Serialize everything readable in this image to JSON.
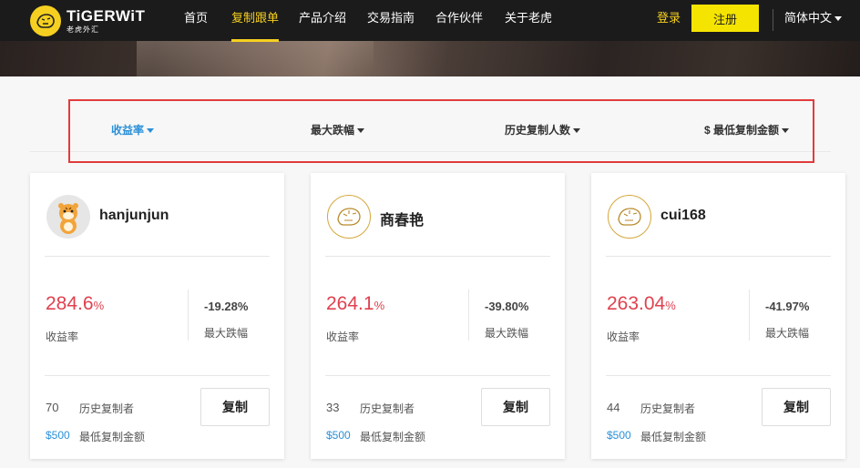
{
  "brand": {
    "name": "TiGERWiT",
    "subtitle": "老虎外汇",
    "accent": "#f5d020"
  },
  "nav": {
    "items": [
      {
        "label": "首页",
        "active": false
      },
      {
        "label": "复制跟单",
        "active": true
      },
      {
        "label": "产品介绍",
        "active": false
      },
      {
        "label": "交易指南",
        "active": false
      },
      {
        "label": "合作伙伴",
        "active": false
      },
      {
        "label": "关于老虎",
        "active": false
      }
    ],
    "login": "登录",
    "register": "注册",
    "language": "简体中文"
  },
  "filters": [
    {
      "label": "收益率",
      "active": true
    },
    {
      "label": "最大跌幅",
      "active": false
    },
    {
      "label": "历史复制人数",
      "active": false
    },
    {
      "label": "$ 最低复制金额",
      "active": false
    }
  ],
  "traders": [
    {
      "name": "hanjunjun",
      "avatar": "tiger-cartoon-photo",
      "return_value": "284.6",
      "return_unit": "%",
      "return_label": "收益率",
      "drawdown": "-19.28%",
      "drawdown_label": "最大跌幅",
      "copiers": "70",
      "copiers_label": "历史复制者",
      "min_amount": "$500",
      "min_amount_label": "最低复制金额",
      "copy_label": "复制"
    },
    {
      "name": "商春艳",
      "avatar": "tiger-logo-outline",
      "return_value": "264.1",
      "return_unit": "%",
      "return_label": "收益率",
      "drawdown": "-39.80%",
      "drawdown_label": "最大跌幅",
      "copiers": "33",
      "copiers_label": "历史复制者",
      "min_amount": "$500",
      "min_amount_label": "最低复制金额",
      "copy_label": "复制"
    },
    {
      "name": "cui168",
      "avatar": "tiger-logo-outline",
      "return_value": "263.04",
      "return_unit": "%",
      "return_label": "收益率",
      "drawdown": "-41.97%",
      "drawdown_label": "最大跌幅",
      "copiers": "44",
      "copiers_label": "历史复制者",
      "min_amount": "$500",
      "min_amount_label": "最低复制金额",
      "copy_label": "复制"
    }
  ]
}
